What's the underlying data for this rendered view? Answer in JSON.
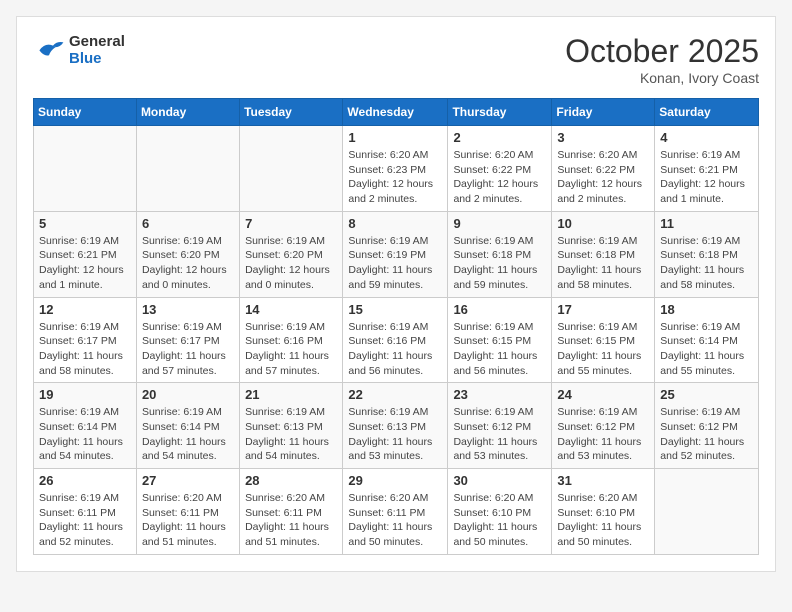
{
  "header": {
    "logo_line1": "General",
    "logo_line2": "Blue",
    "month": "October 2025",
    "location": "Konan, Ivory Coast"
  },
  "weekdays": [
    "Sunday",
    "Monday",
    "Tuesday",
    "Wednesday",
    "Thursday",
    "Friday",
    "Saturday"
  ],
  "weeks": [
    [
      {
        "day": "",
        "info": ""
      },
      {
        "day": "",
        "info": ""
      },
      {
        "day": "",
        "info": ""
      },
      {
        "day": "1",
        "info": "Sunrise: 6:20 AM\nSunset: 6:23 PM\nDaylight: 12 hours and 2 minutes."
      },
      {
        "day": "2",
        "info": "Sunrise: 6:20 AM\nSunset: 6:22 PM\nDaylight: 12 hours and 2 minutes."
      },
      {
        "day": "3",
        "info": "Sunrise: 6:20 AM\nSunset: 6:22 PM\nDaylight: 12 hours and 2 minutes."
      },
      {
        "day": "4",
        "info": "Sunrise: 6:19 AM\nSunset: 6:21 PM\nDaylight: 12 hours and 1 minute."
      }
    ],
    [
      {
        "day": "5",
        "info": "Sunrise: 6:19 AM\nSunset: 6:21 PM\nDaylight: 12 hours and 1 minute."
      },
      {
        "day": "6",
        "info": "Sunrise: 6:19 AM\nSunset: 6:20 PM\nDaylight: 12 hours and 0 minutes."
      },
      {
        "day": "7",
        "info": "Sunrise: 6:19 AM\nSunset: 6:20 PM\nDaylight: 12 hours and 0 minutes."
      },
      {
        "day": "8",
        "info": "Sunrise: 6:19 AM\nSunset: 6:19 PM\nDaylight: 11 hours and 59 minutes."
      },
      {
        "day": "9",
        "info": "Sunrise: 6:19 AM\nSunset: 6:18 PM\nDaylight: 11 hours and 59 minutes."
      },
      {
        "day": "10",
        "info": "Sunrise: 6:19 AM\nSunset: 6:18 PM\nDaylight: 11 hours and 58 minutes."
      },
      {
        "day": "11",
        "info": "Sunrise: 6:19 AM\nSunset: 6:18 PM\nDaylight: 11 hours and 58 minutes."
      }
    ],
    [
      {
        "day": "12",
        "info": "Sunrise: 6:19 AM\nSunset: 6:17 PM\nDaylight: 11 hours and 58 minutes."
      },
      {
        "day": "13",
        "info": "Sunrise: 6:19 AM\nSunset: 6:17 PM\nDaylight: 11 hours and 57 minutes."
      },
      {
        "day": "14",
        "info": "Sunrise: 6:19 AM\nSunset: 6:16 PM\nDaylight: 11 hours and 57 minutes."
      },
      {
        "day": "15",
        "info": "Sunrise: 6:19 AM\nSunset: 6:16 PM\nDaylight: 11 hours and 56 minutes."
      },
      {
        "day": "16",
        "info": "Sunrise: 6:19 AM\nSunset: 6:15 PM\nDaylight: 11 hours and 56 minutes."
      },
      {
        "day": "17",
        "info": "Sunrise: 6:19 AM\nSunset: 6:15 PM\nDaylight: 11 hours and 55 minutes."
      },
      {
        "day": "18",
        "info": "Sunrise: 6:19 AM\nSunset: 6:14 PM\nDaylight: 11 hours and 55 minutes."
      }
    ],
    [
      {
        "day": "19",
        "info": "Sunrise: 6:19 AM\nSunset: 6:14 PM\nDaylight: 11 hours and 54 minutes."
      },
      {
        "day": "20",
        "info": "Sunrise: 6:19 AM\nSunset: 6:14 PM\nDaylight: 11 hours and 54 minutes."
      },
      {
        "day": "21",
        "info": "Sunrise: 6:19 AM\nSunset: 6:13 PM\nDaylight: 11 hours and 54 minutes."
      },
      {
        "day": "22",
        "info": "Sunrise: 6:19 AM\nSunset: 6:13 PM\nDaylight: 11 hours and 53 minutes."
      },
      {
        "day": "23",
        "info": "Sunrise: 6:19 AM\nSunset: 6:12 PM\nDaylight: 11 hours and 53 minutes."
      },
      {
        "day": "24",
        "info": "Sunrise: 6:19 AM\nSunset: 6:12 PM\nDaylight: 11 hours and 53 minutes."
      },
      {
        "day": "25",
        "info": "Sunrise: 6:19 AM\nSunset: 6:12 PM\nDaylight: 11 hours and 52 minutes."
      }
    ],
    [
      {
        "day": "26",
        "info": "Sunrise: 6:19 AM\nSunset: 6:11 PM\nDaylight: 11 hours and 52 minutes."
      },
      {
        "day": "27",
        "info": "Sunrise: 6:20 AM\nSunset: 6:11 PM\nDaylight: 11 hours and 51 minutes."
      },
      {
        "day": "28",
        "info": "Sunrise: 6:20 AM\nSunset: 6:11 PM\nDaylight: 11 hours and 51 minutes."
      },
      {
        "day": "29",
        "info": "Sunrise: 6:20 AM\nSunset: 6:11 PM\nDaylight: 11 hours and 50 minutes."
      },
      {
        "day": "30",
        "info": "Sunrise: 6:20 AM\nSunset: 6:10 PM\nDaylight: 11 hours and 50 minutes."
      },
      {
        "day": "31",
        "info": "Sunrise: 6:20 AM\nSunset: 6:10 PM\nDaylight: 11 hours and 50 minutes."
      },
      {
        "day": "",
        "info": ""
      }
    ]
  ]
}
